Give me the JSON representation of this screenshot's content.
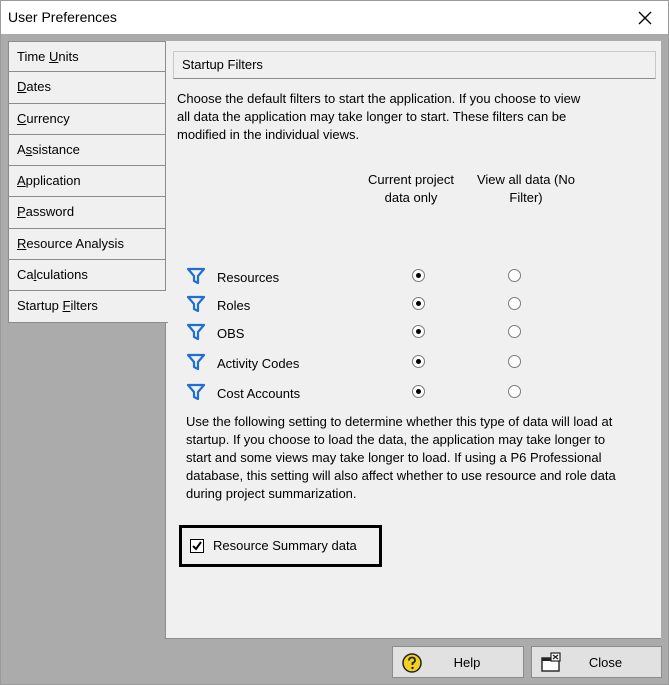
{
  "window": {
    "title": "User Preferences"
  },
  "tabs": [
    {
      "label": "Time Units",
      "key": "U",
      "active": false
    },
    {
      "label": "Dates",
      "key": "D",
      "active": false
    },
    {
      "label": "Currency",
      "key": "C",
      "active": false
    },
    {
      "label": "Assistance",
      "key": "s",
      "active": false
    },
    {
      "label": "Application",
      "key": "A",
      "active": false
    },
    {
      "label": "Password",
      "key": "P",
      "active": false
    },
    {
      "label": "Resource Analysis",
      "key": "R",
      "active": false
    },
    {
      "label": "Calculations",
      "key": "l",
      "active": false
    },
    {
      "label": "Startup Filters",
      "key": "F",
      "active": true
    }
  ],
  "panel": {
    "header": "Startup Filters",
    "intro": "Choose the default filters to start the application.  If you choose to view all data the application may take longer to start.  These filters can be modified in the individual views.",
    "col1": "Current project data only",
    "col2": "View all data (No Filter)",
    "rows": [
      {
        "label": "Resources",
        "selected": "current"
      },
      {
        "label": "Roles",
        "selected": "current"
      },
      {
        "label": "OBS",
        "selected": "current"
      },
      {
        "label": "Activity Codes",
        "selected": "current"
      },
      {
        "label": "Cost Accounts",
        "selected": "current"
      }
    ],
    "note": "Use the following setting to determine whether this type of data will load at startup. If you choose to load the data, the application may take longer to start and some views may take longer to load. If using a P6 Professional database, this setting will also affect whether to use resource and role data during project summarization.",
    "checkbox": {
      "label": "Resource Summary data",
      "checked": true
    }
  },
  "buttons": {
    "help": "Help",
    "close": "Close"
  },
  "icons": {
    "filter": "filter-funnel-icon",
    "help": "help-question-icon",
    "close": "close-window-icon"
  },
  "colors": {
    "filter_icon": "#1f6fd1",
    "help_icon": "#e6c200"
  }
}
